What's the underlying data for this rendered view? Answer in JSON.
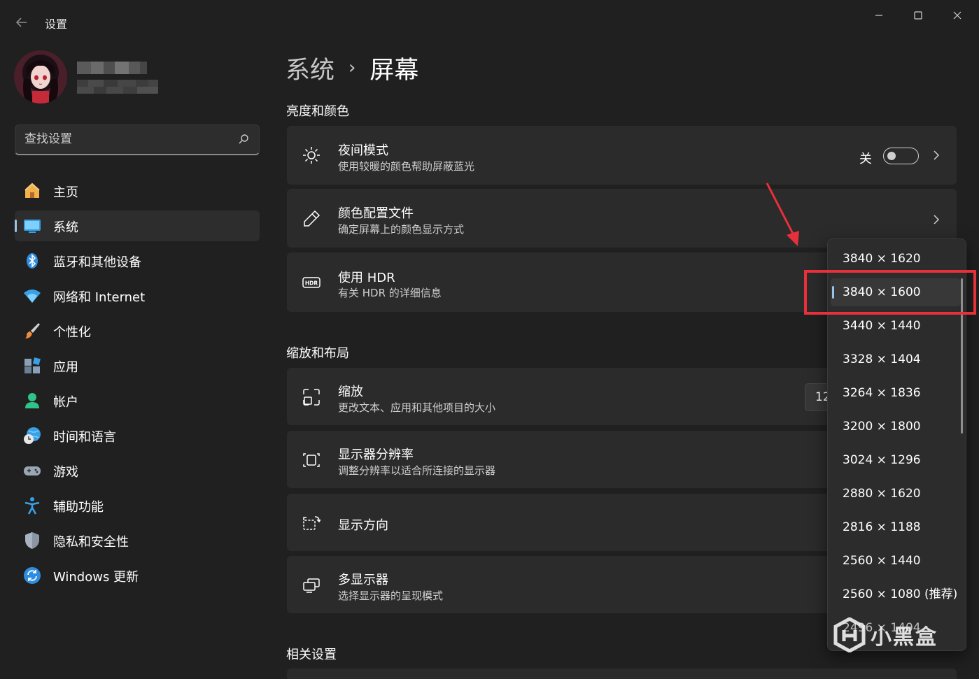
{
  "window": {
    "title": "设置",
    "back_icon": "back-arrow-icon",
    "controls": [
      "minimize-icon",
      "maximize-icon",
      "close-icon"
    ]
  },
  "profile": {
    "avatar_icon": "avatar-anime-girl",
    "name_redacted": true,
    "email_redacted": true
  },
  "search": {
    "placeholder": "查找设置",
    "icon": "search-icon"
  },
  "sidebar": {
    "selected_index": 1,
    "accent_color": "#99c3e8",
    "items": [
      {
        "label": "主页",
        "icon": "home-icon"
      },
      {
        "label": "系统",
        "icon": "system-display-icon"
      },
      {
        "label": "蓝牙和其他设备",
        "icon": "bluetooth-icon"
      },
      {
        "label": "网络和 Internet",
        "icon": "wifi-icon"
      },
      {
        "label": "个性化",
        "icon": "paint-brush-icon"
      },
      {
        "label": "应用",
        "icon": "apps-icon"
      },
      {
        "label": "帐户",
        "icon": "account-icon"
      },
      {
        "label": "时间和语言",
        "icon": "globe-clock-icon"
      },
      {
        "label": "游戏",
        "icon": "gamepad-icon"
      },
      {
        "label": "辅助功能",
        "icon": "accessibility-icon"
      },
      {
        "label": "隐私和安全性",
        "icon": "shield-icon"
      },
      {
        "label": "Windows 更新",
        "icon": "update-icon"
      }
    ]
  },
  "breadcrumb": {
    "parent": "系统",
    "separator": "›",
    "current": "屏幕"
  },
  "sections": {
    "brightness": {
      "title": "亮度和颜色",
      "night_light": {
        "title": "夜间模式",
        "subtitle": "使用较暖的颜色帮助屏蔽蓝光",
        "state_label": "关",
        "toggle_on": false,
        "icon": "brightness-icon"
      },
      "color_profile": {
        "title": "颜色配置文件",
        "subtitle": "确定屏幕上的颜色显示方式",
        "icon": "eyedropper-icon"
      },
      "hdr": {
        "title": "使用 HDR",
        "subtitle": "有关 HDR 的详细信息",
        "icon": "hdr-icon"
      }
    },
    "scale_layout": {
      "title": "缩放和布局",
      "scale": {
        "title": "缩放",
        "subtitle": "更改文本、应用和其他项目的大小",
        "value": "12",
        "icon": "scale-icon"
      },
      "resolution": {
        "title": "显示器分辨率",
        "subtitle": "调整分辨率以适合所连接的显示器",
        "icon": "resolution-icon"
      },
      "orientation": {
        "title": "显示方向",
        "icon": "orientation-icon"
      },
      "multi_display": {
        "title": "多显示器",
        "subtitle": "选择显示器的呈现模式",
        "icon": "multi-display-icon"
      }
    },
    "related": {
      "title": "相关设置"
    }
  },
  "resolution_dropdown": {
    "selected_index": 1,
    "options": [
      "3840 × 1620",
      "3840 × 1600",
      "3440 × 1440",
      "3328 × 1404",
      "3264 × 1836",
      "3200 × 1800",
      "3024 × 1296",
      "2880 × 1620",
      "2816 × 1188",
      "2560 × 1440",
      "2560 × 1080 (推荐)",
      "2496 × 1404"
    ]
  },
  "annotation": {
    "highlight_color": "#e8303a"
  },
  "watermark": {
    "text": "小黑盒",
    "icon": "xiaoheihe-logo-icon"
  }
}
